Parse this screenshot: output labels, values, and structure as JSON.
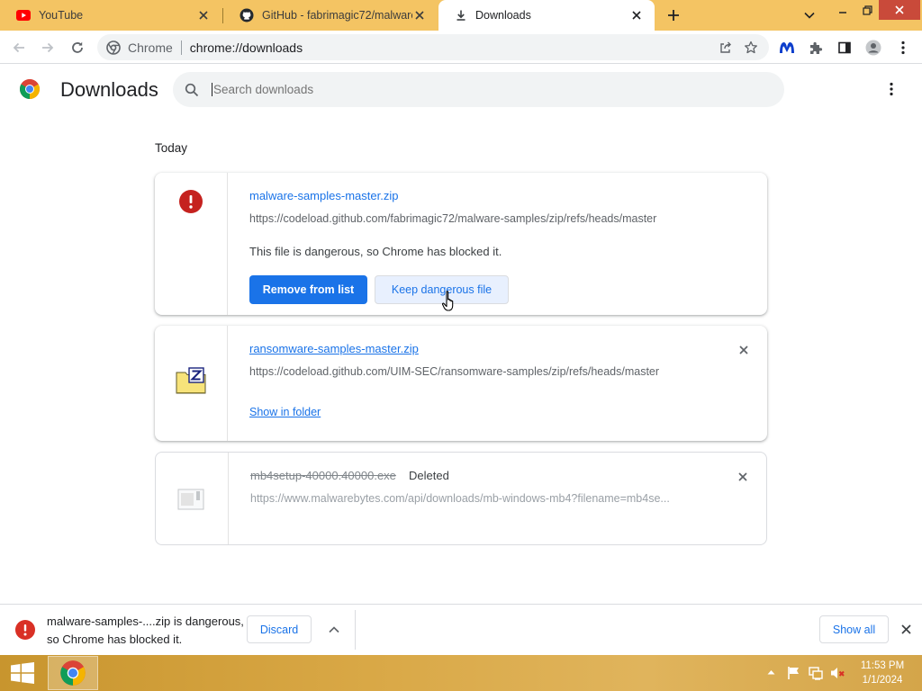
{
  "tabs": [
    {
      "label": "YouTube",
      "icon": "youtube-icon"
    },
    {
      "label": "GitHub - fabrimagic72/malware-",
      "icon": "github-icon"
    },
    {
      "label": "Downloads",
      "icon": "download-icon"
    }
  ],
  "omnibox": {
    "site_label": "Chrome",
    "url": "chrome://downloads"
  },
  "header": {
    "title": "Downloads",
    "search_placeholder": "Search downloads"
  },
  "section_label": "Today",
  "downloads": [
    {
      "filename": "malware-samples-master.zip",
      "url": "https://codeload.github.com/fabrimagic72/malware-samples/zip/refs/heads/master",
      "status_text": "This file is dangerous, so Chrome has blocked it.",
      "primary_button": "Remove from list",
      "secondary_button": "Keep dangerous file",
      "icon": "danger-icon"
    },
    {
      "filename": "ransomware-samples-master.zip",
      "url": "https://codeload.github.com/UIM-SEC/ransomware-samples/zip/refs/heads/master",
      "action_link": "Show in folder",
      "icon": "zip-folder-icon"
    },
    {
      "filename": "mb4setup-40000.40000.exe",
      "status_tag": "Deleted",
      "url": "https://www.malwarebytes.com/api/downloads/mb-windows-mb4?filename=mb4se...",
      "icon": "file-icon"
    }
  ],
  "download_bar": {
    "message_line1": "malware-samples-....zip is dangerous,",
    "message_line2": "so Chrome has blocked it.",
    "discard_label": "Discard",
    "show_all_label": "Show all"
  },
  "taskbar": {
    "time": "11:53 PM",
    "date": "1/1/2024"
  },
  "colors": {
    "accent": "#1a73e8",
    "danger": "#d93025",
    "tabstrip": "#f4c463",
    "taskbar": "#d9a846"
  }
}
